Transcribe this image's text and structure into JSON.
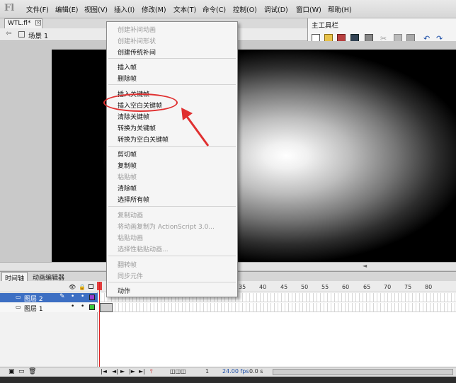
{
  "app": {
    "logo": "Fl"
  },
  "menubar": {
    "items": [
      "文件(F)",
      "编辑(E)",
      "视图(V)",
      "插入(I)",
      "修改(M)",
      "文本(T)",
      "命令(C)",
      "控制(O)",
      "调试(D)",
      "窗口(W)",
      "帮助(H)"
    ]
  },
  "document": {
    "tab_label": "WTL.fl*",
    "close_glyph": "×",
    "scene_label": "场景 1"
  },
  "toolbar_panel": {
    "title": "主工具栏"
  },
  "context_menu": {
    "items": [
      {
        "label": "创建补间动画",
        "enabled": false
      },
      {
        "label": "创建补间形状",
        "enabled": false
      },
      {
        "label": "创建传统补间",
        "enabled": true
      },
      {
        "label": "插入帧",
        "enabled": true
      },
      {
        "label": "删除帧",
        "enabled": true
      },
      {
        "label": "插入关键帧",
        "enabled": true
      },
      {
        "label": "插入空白关键帧",
        "enabled": true
      },
      {
        "label": "清除关键帧",
        "enabled": true
      },
      {
        "label": "转换为关键帧",
        "enabled": true
      },
      {
        "label": "转换为空白关键帧",
        "enabled": true
      },
      {
        "label": "剪切帧",
        "enabled": true
      },
      {
        "label": "复制帧",
        "enabled": true
      },
      {
        "label": "粘贴帧",
        "enabled": false
      },
      {
        "label": "清除帧",
        "enabled": true
      },
      {
        "label": "选择所有帧",
        "enabled": true
      },
      {
        "label": "复制动画",
        "enabled": false
      },
      {
        "label": "将动画复制为 ActionScript 3.0...",
        "enabled": false
      },
      {
        "label": "粘贴动画",
        "enabled": false
      },
      {
        "label": "选择性粘贴动画...",
        "enabled": false
      },
      {
        "label": "翻转帧",
        "enabled": false
      },
      {
        "label": "同步元件",
        "enabled": false
      },
      {
        "label": "动作",
        "enabled": true
      }
    ],
    "highlighted": "插入空白关键帧"
  },
  "timeline": {
    "tabs": [
      "时间轴",
      "动画编辑器"
    ],
    "layers": [
      {
        "name": "图层 2",
        "selected": true,
        "color": "#9a3dd0"
      },
      {
        "name": "图层 1",
        "selected": false,
        "color": "#39c739"
      }
    ],
    "ruler": [
      "35",
      "40",
      "45",
      "50",
      "55",
      "60",
      "65",
      "70",
      "75",
      "80"
    ],
    "status": {
      "frame": "1",
      "fps": "24.00 fps",
      "time": "0.0 s"
    }
  },
  "colors": {
    "annotation": "#e03030",
    "selection": "#3d6fc3"
  }
}
